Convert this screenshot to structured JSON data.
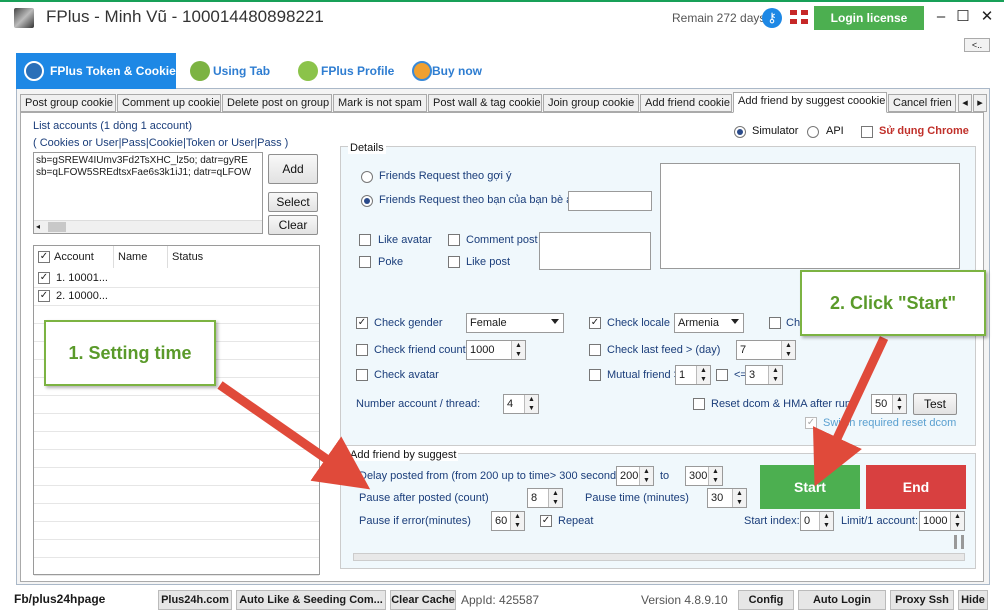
{
  "window": {
    "title": "FPlus - Minh Vũ - 100014480898221",
    "remain": "Remain 272 days",
    "login_license": "Login license",
    "minimize": "–",
    "maximize": "☐",
    "close": "✕",
    "collapse_btn": "<.."
  },
  "main_tabs": [
    {
      "label": "FPlus Token & Cookie",
      "icon": "token-icon"
    },
    {
      "label": "Using Tab",
      "icon": "link-icon"
    },
    {
      "label": "FPlus Profile",
      "icon": "people-icon"
    },
    {
      "label": "Buy now",
      "icon": "refresh-icon"
    }
  ],
  "sub_tabs": [
    "Post group cookie",
    "Comment up cookie",
    "Delete post on group",
    "Mark is not spam",
    "Post wall & tag cookie",
    "Join group cookie",
    "Add friend cookie",
    "Add friend by suggest coookie",
    "Cancel frien"
  ],
  "accounts": {
    "title": "List accounts (1 dòng 1 account)",
    "format": "( Cookies or User|Pass|Cookie|Token or User|Pass )",
    "lines": [
      "sb=gSREW4IUmv3Fd2TsXHC_lz5o; datr=gyRE",
      "sb=qLFOW5SREdtsxFae6s3k1iJ1; datr=qLFOW"
    ],
    "add": "Add",
    "select": "Select",
    "clear": "Clear",
    "columns": [
      "Account",
      "Name",
      "Status"
    ],
    "rows": [
      {
        "account": "1. 10001...",
        "checked": true
      },
      {
        "account": "2. 10000...",
        "checked": true
      }
    ]
  },
  "mode": {
    "simulator": "Simulator",
    "api": "API",
    "chrome": "Sử dụng Chrome"
  },
  "details": {
    "legend": "Details",
    "radio1": "Friends Request theo gợi ý",
    "radio2": "Friends Request theo bạn của bạn bè and vị trí",
    "like_avatar": "Like avatar",
    "comment_post": "Comment post",
    "poke": "Poke",
    "like_post": "Like post",
    "check_gender": "Check gender",
    "gender_value": "Female",
    "check_locale": "Check locale",
    "locale_value": "Armenia",
    "check_friend_count": "Check friend count",
    "friend_count_value": "1000",
    "check_last_feed": "Check last feed > (day)",
    "last_feed_value": "7",
    "check_avatar": "Check avatar",
    "mutual_friend": "Mutual friend >",
    "mutual_value": "1",
    "mutual_le": "<=",
    "mutual_le_value": "3",
    "number_account": "Number account / thread:",
    "number_account_value": "4",
    "reset_dcom": "Reset dcom & HMA after run",
    "reset_value": "50",
    "test": "Test",
    "switch_required": "Switch required reset dcom",
    "ch_partial": "Ch"
  },
  "suggest": {
    "legend": "Add friend by suggest",
    "delay": "Delay posted from (from 200 up to time> 300 seconds)",
    "delay_from": "200",
    "to": "to",
    "delay_to": "300",
    "pause_after": "Pause after posted (count)",
    "pause_after_value": "8",
    "pause_time": "Pause time (minutes)",
    "pause_time_value": "30",
    "pause_error": "Pause if error(minutes)",
    "pause_error_value": "60",
    "repeat": "Repeat",
    "start_index": "Start index:",
    "start_index_value": "0",
    "limit": "Limit/1 account:",
    "limit_value": "1000",
    "start": "Start",
    "end": "End"
  },
  "annotations": {
    "step1": "1. Setting time",
    "step2": "2. Click \"Start\""
  },
  "statusbar": {
    "page": "Fb/plus24hpage",
    "buttons": [
      "Plus24h.com",
      "Auto Like & Seeding Com...",
      "Clear Cache"
    ],
    "appid": "AppId: 425587",
    "version": "Version 4.8.9.10",
    "right_buttons": [
      "Config",
      "Auto Login",
      "Proxy Ssh",
      "Hide"
    ]
  },
  "colors": {
    "accent_blue": "#1e88e5",
    "green": "#4caf50",
    "red": "#d84040",
    "arrow": "#e04a3a"
  }
}
